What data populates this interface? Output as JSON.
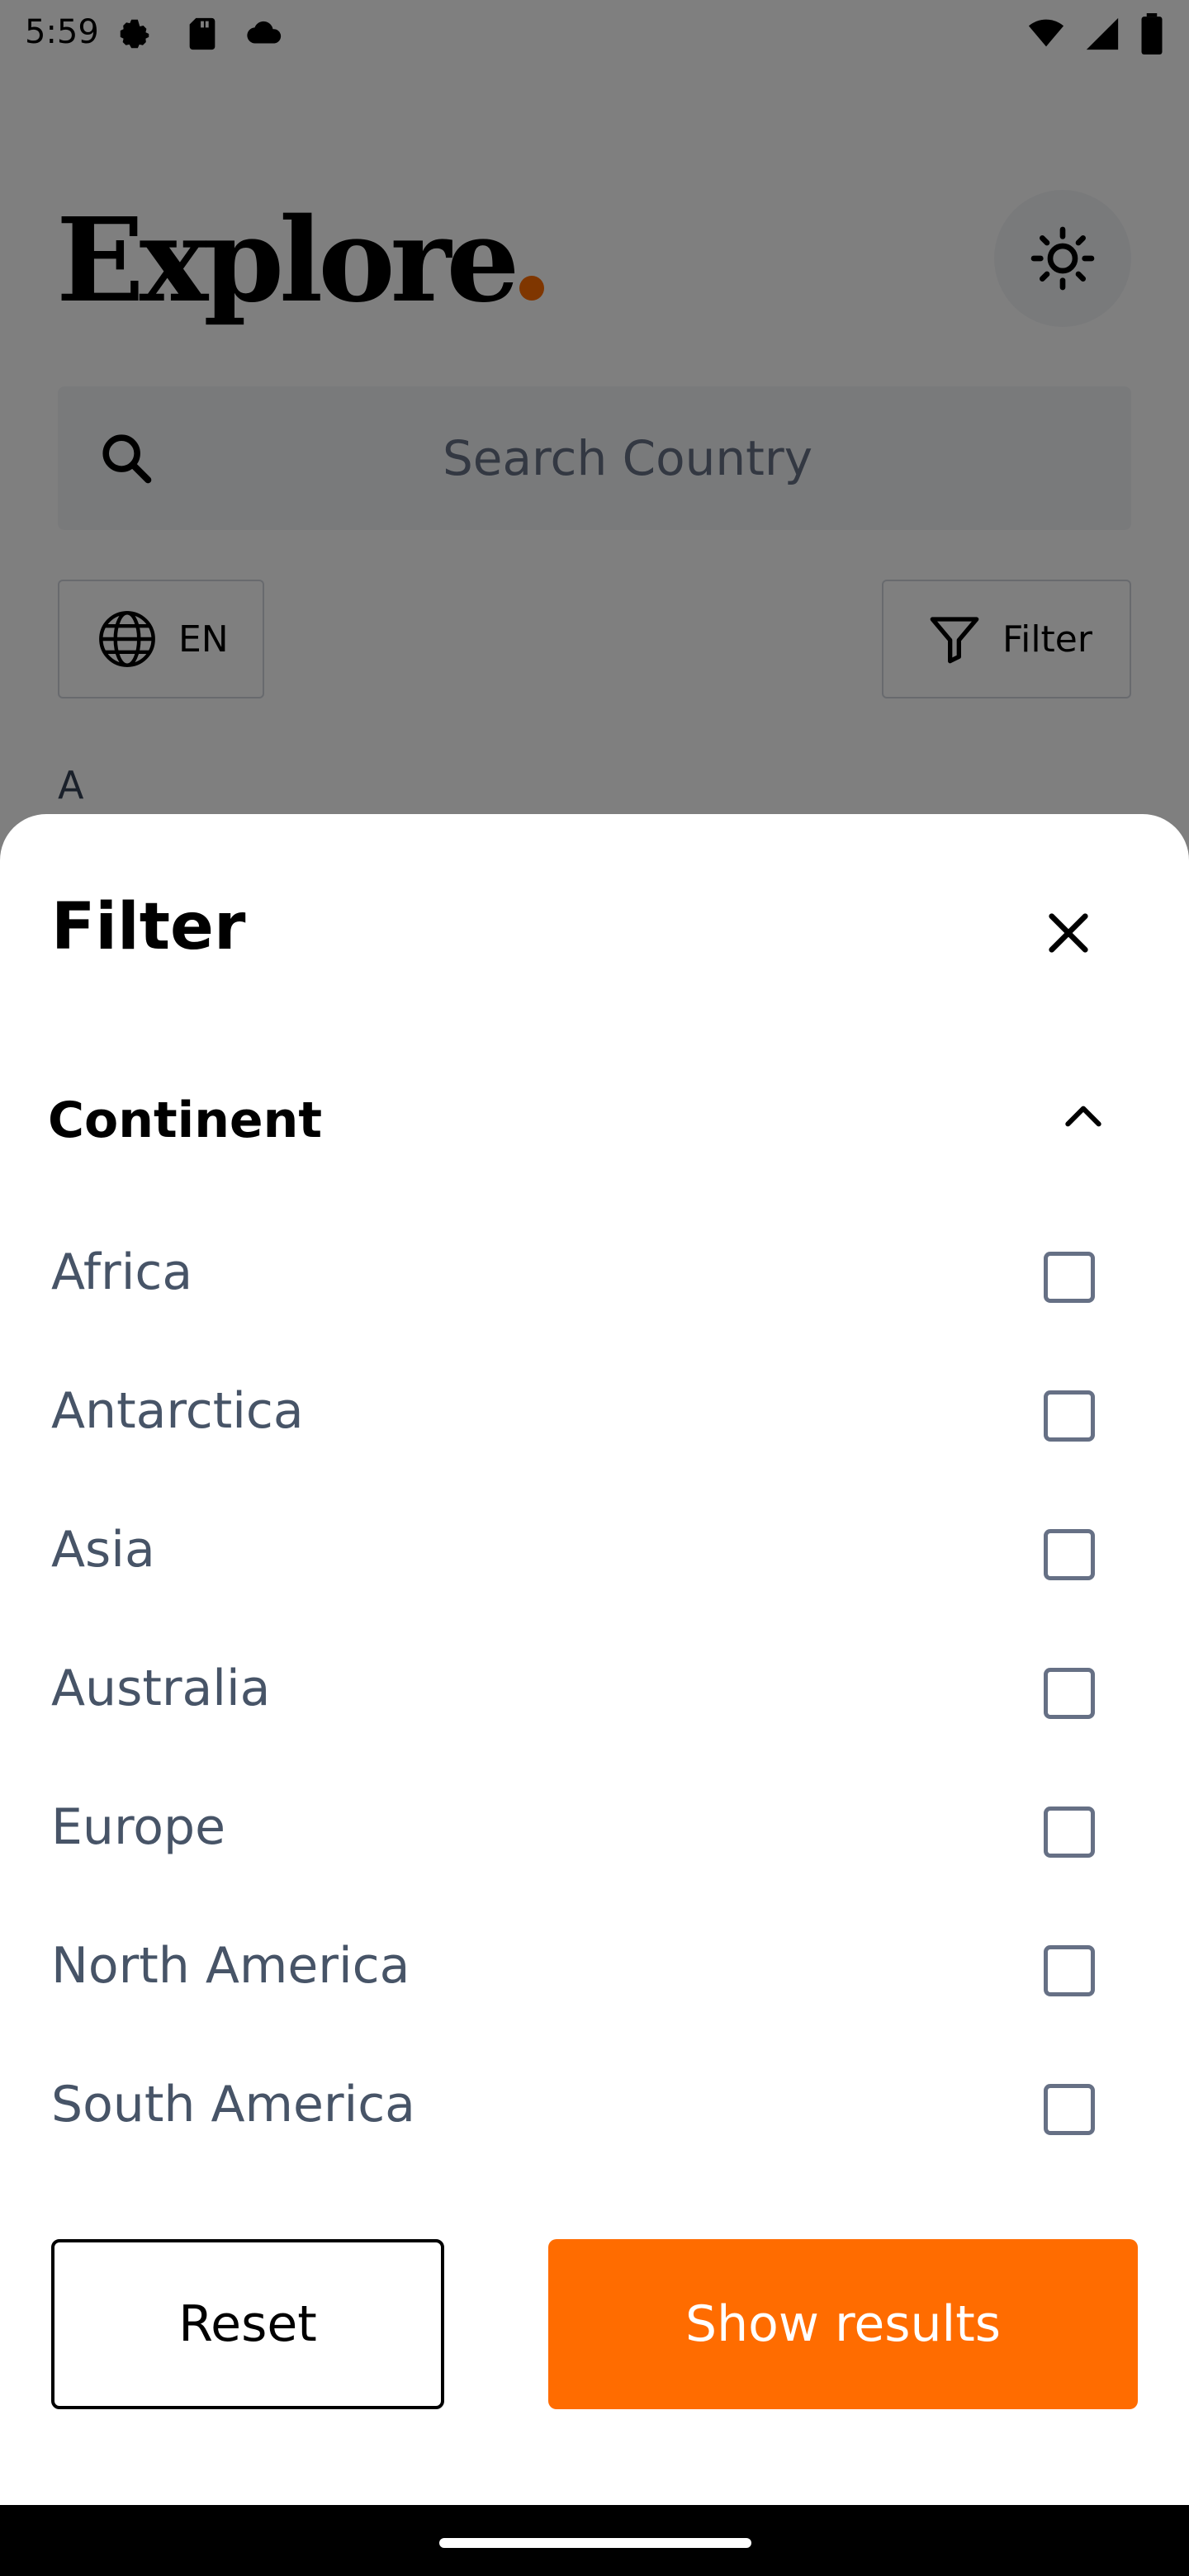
{
  "status_bar": {
    "time": "5:59",
    "left_icons": [
      "gear-icon",
      "sd-card-icon",
      "cloud-icon"
    ],
    "right_icons": [
      "wifi-icon",
      "signal-icon",
      "battery-icon"
    ]
  },
  "header": {
    "title": "Explore",
    "dot_color": "#ff6c00",
    "theme_icon": "sun-icon"
  },
  "search": {
    "placeholder": "Search Country"
  },
  "language_button": {
    "label": "EN",
    "icon": "globe-icon"
  },
  "filter_button": {
    "label": "Filter",
    "icon": "funnel-icon"
  },
  "list_section_letter": "A",
  "filter_sheet": {
    "title": "Filter",
    "close_icon": "close-icon",
    "section": {
      "label": "Continent",
      "expanded": true,
      "icon": "chevron-up-icon"
    },
    "options": [
      {
        "label": "Africa",
        "checked": false
      },
      {
        "label": "Antarctica",
        "checked": false
      },
      {
        "label": "Asia",
        "checked": false
      },
      {
        "label": "Australia",
        "checked": false
      },
      {
        "label": "Europe",
        "checked": false
      },
      {
        "label": "North America",
        "checked": false
      },
      {
        "label": "South America",
        "checked": false
      }
    ],
    "reset_label": "Reset",
    "show_results_label": "Show results"
  },
  "colors": {
    "accent": "#ff6c00",
    "scrim": "rgba(0,0,0,0.5)"
  }
}
